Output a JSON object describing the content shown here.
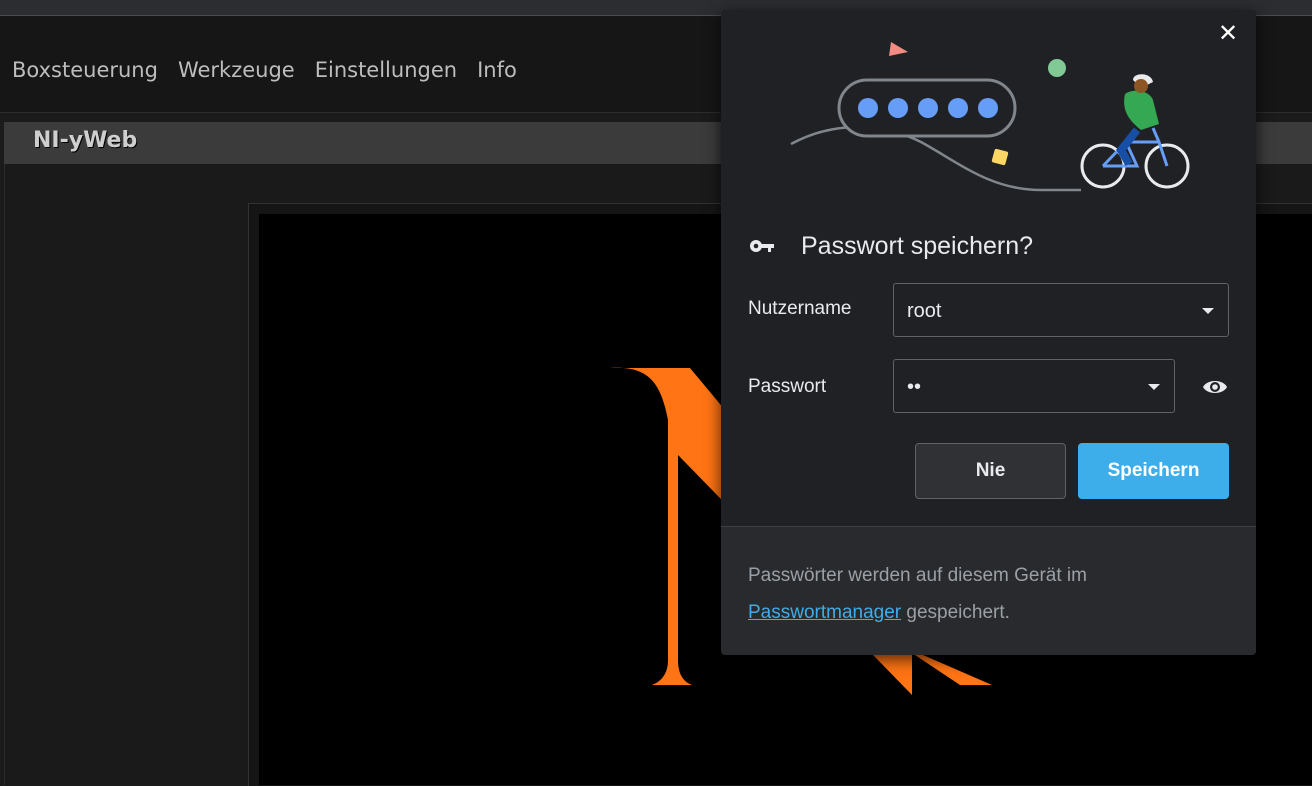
{
  "menubar": {
    "items": [
      "Boxsteuerung",
      "Werkzeuge",
      "Einstellungen",
      "Info"
    ]
  },
  "app": {
    "title": "NI-yWeb"
  },
  "popup": {
    "heading": "Passwort speichern?",
    "username_label": "Nutzername",
    "username_value": "root",
    "password_label": "Passwort",
    "password_value": "••",
    "never_button": "Nie",
    "save_button": "Speichern",
    "footer_text_before": "Passwörter werden auf diesem Gerät im",
    "footer_link": "Passwortmanager",
    "footer_text_after": " gespeichert.",
    "close_icon": "close-icon"
  },
  "colors": {
    "accent": "#3daee9",
    "logo": "#ff7414",
    "popup_bg": "#202124"
  }
}
